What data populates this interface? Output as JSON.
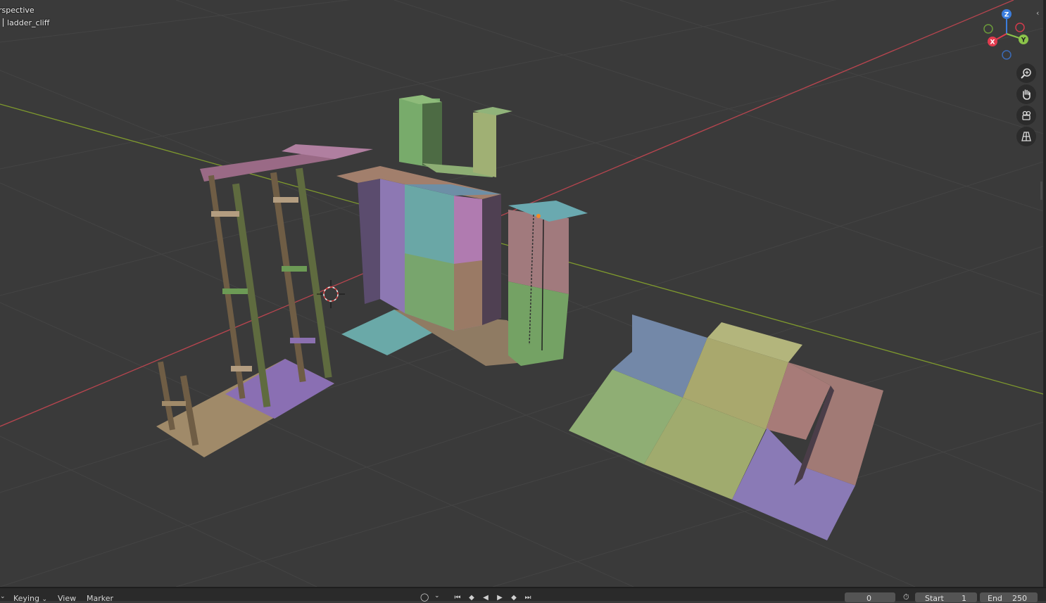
{
  "viewport": {
    "view_mode": "rspective",
    "object_name": "ladder_cliff"
  },
  "gizmo": {
    "x_label": "X",
    "y_label": "Y",
    "z_label": "Z",
    "x_color": "#e23b4e",
    "y_color": "#8bc34a",
    "z_color": "#3b7ddd"
  },
  "navigation": {
    "zoom_icon": "zoom-in-icon",
    "pan_icon": "hand-pan-icon",
    "camera_icon": "camera-view-icon",
    "ortho_icon": "perspective-grid-icon"
  },
  "timeline": {
    "keying_label": "Keying",
    "view_label": "View",
    "marker_label": "Marker",
    "current_frame": "0",
    "start_label": "Start",
    "start_value": "1",
    "end_label": "End",
    "end_value": "250"
  },
  "colors": {
    "background": "#3a3a3a",
    "x_axis": "#b8454f",
    "y_axis": "#7f9a2d",
    "grid": "#444444"
  }
}
